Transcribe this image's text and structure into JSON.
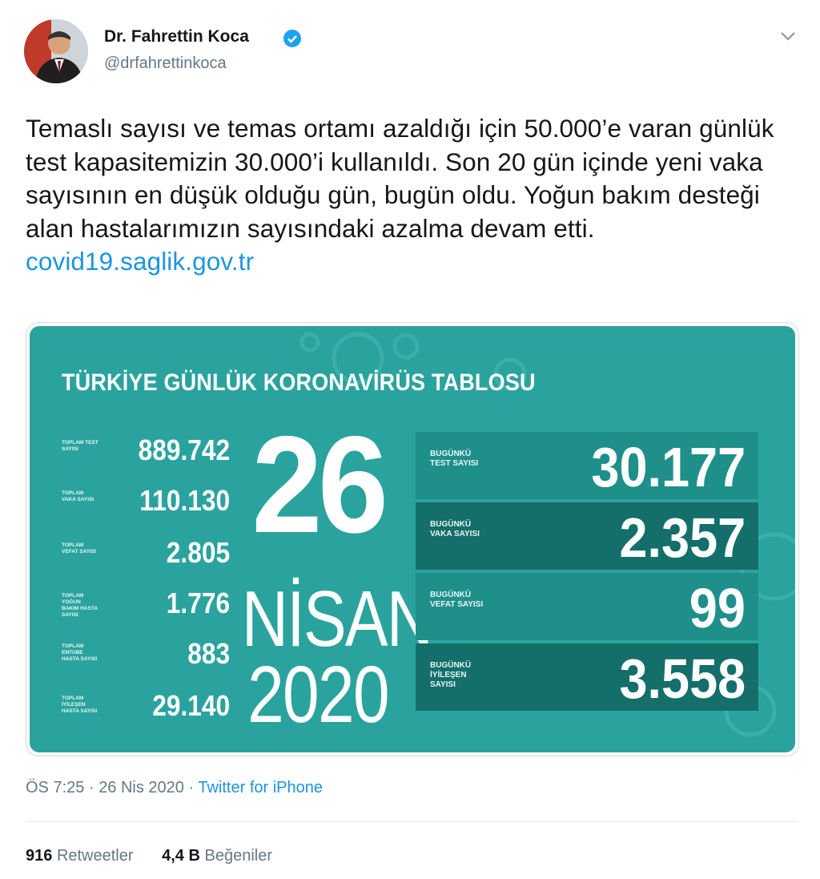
{
  "author": {
    "display_name": "Dr. Fahrettin Koca",
    "handle": "@drfahrettinkoca",
    "verified": true,
    "avatar_icon": "profile-photo"
  },
  "tweet": {
    "text_main": "Temaslı sayısı ve temas ortamı azaldığı için 50.000’e varan günlük test kapasitemizin 30.000’i kullanıldı. Son 20 gün içinde yeni vaka sayısının en düşük olduğu gün, bugün oldu. Yoğun bakım desteği alan hastalarımızın sayısındaki azalma devam etti. ",
    "link": "covid19.saglik.gov.tr"
  },
  "card": {
    "title": "TÜRKİYE GÜNLÜK KORONAVİRÜS TABLOSU",
    "day": "26",
    "month": "NİSAN",
    "year": "2020",
    "totals": [
      {
        "label": "TOPLAM TEST SAYISI",
        "value": "889.742"
      },
      {
        "label": "TOPLAM VAKA SAYISI",
        "value": "110.130"
      },
      {
        "label": "TOPLAM VEFAT SAYISI",
        "value": "2.805"
      },
      {
        "label": "TOPLAM YOĞUN BAKIM HASTA SAYISI",
        "value": "1.776"
      },
      {
        "label": "TOPLAM ENTUBE HASTA SAYISI",
        "value": "883"
      },
      {
        "label": "TOPLAM İYİLEŞEN HASTA SAYISI",
        "value": "29.140"
      }
    ],
    "today": [
      {
        "label": "BUGÜNKÜ TEST SAYISI",
        "value": "30.177"
      },
      {
        "label": "BUGÜNKÜ VAKA SAYISI",
        "value": "2.357"
      },
      {
        "label": "BUGÜNKÜ VEFAT SAYISI",
        "value": "99"
      },
      {
        "label": "BUGÜNKÜ İYİLEŞEN SAYISI",
        "value": "3.558"
      }
    ],
    "colors": {
      "background": "#2aa39e",
      "row_light": "#1f8f8a",
      "row_dark": "#146e69"
    }
  },
  "meta": {
    "time": "ÖS 7:25",
    "date": "26 Nis 2020",
    "separator": "·",
    "source": "Twitter for iPhone"
  },
  "stats": {
    "retweets_count": "916",
    "retweets_label": "Retweetler",
    "likes_count": "4,4 B",
    "likes_label": "Beğeniler"
  }
}
